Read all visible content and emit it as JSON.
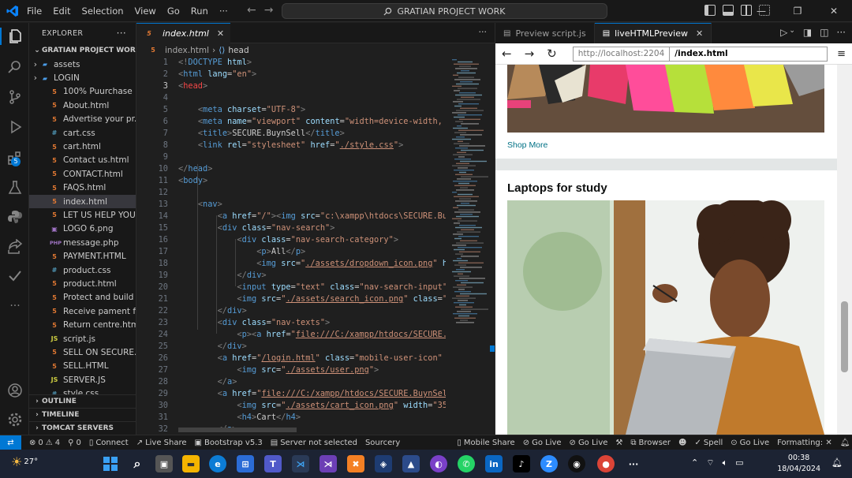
{
  "menu": [
    "File",
    "Edit",
    "Selection",
    "View",
    "Go",
    "Run",
    "···"
  ],
  "command_center": "GRATIAN PROJECT WORK",
  "sidebar": {
    "title": "EXPLORER",
    "root": "GRATIAN PROJECT WORK",
    "items": [
      {
        "label": "assets",
        "type": "folder"
      },
      {
        "label": "LOGIN",
        "type": "folder"
      },
      {
        "label": "100% Puurchase ...",
        "type": "html"
      },
      {
        "label": "About.html",
        "type": "html"
      },
      {
        "label": "Advertise your pr...",
        "type": "html"
      },
      {
        "label": "cart.css",
        "type": "css"
      },
      {
        "label": "cart.html",
        "type": "html"
      },
      {
        "label": "Contact us.html",
        "type": "html"
      },
      {
        "label": "CONTACT.html",
        "type": "html"
      },
      {
        "label": "FAQS.html",
        "type": "html"
      },
      {
        "label": "index.html",
        "type": "html",
        "selected": true
      },
      {
        "label": "LET US HELP YOU...",
        "type": "html"
      },
      {
        "label": "LOGO 6.png",
        "type": "png"
      },
      {
        "label": "message.php",
        "type": "php"
      },
      {
        "label": "PAYMENT.HTML",
        "type": "html"
      },
      {
        "label": "product.css",
        "type": "css"
      },
      {
        "label": "product.html",
        "type": "html"
      },
      {
        "label": "Protect and build ...",
        "type": "html"
      },
      {
        "label": "Receive pament f...",
        "type": "html"
      },
      {
        "label": "Return centre.html",
        "type": "html"
      },
      {
        "label": "script.js",
        "type": "js"
      },
      {
        "label": "SELL ON SECURE....",
        "type": "html"
      },
      {
        "label": "SELL.HTML",
        "type": "html"
      },
      {
        "label": "SERVER.JS",
        "type": "js"
      },
      {
        "label": "style.css",
        "type": "css"
      }
    ],
    "sections": [
      "OUTLINE",
      "TIMELINE",
      "TOMCAT SERVERS"
    ]
  },
  "editor": {
    "tab": "index.html",
    "breadcrumb_file": "index.html",
    "breadcrumb_symbol": "head",
    "current_line": 3
  },
  "preview": {
    "tabs": [
      "Preview script.js",
      "liveHTMLPreview"
    ],
    "url_host": "http://localhost:2204",
    "url_path": "/index.html",
    "shop_more": "Shop More",
    "card_title": "Laptops for study"
  },
  "status": {
    "problems": "0",
    "warnings": "4",
    "ports": "0",
    "items": [
      "Connect",
      "Live Share",
      "Bootstrap v5.3",
      "Server not selected",
      "Sourcery",
      "Mobile Share",
      "Go Live",
      "Go Live",
      "Browser",
      "Spell",
      "Go Live",
      "Formatting: ✕"
    ]
  },
  "taskbar": {
    "weather": "27°",
    "time": "00:38",
    "date": "18/04/2024"
  },
  "colors": {
    "accent": "#0078d4",
    "tag": "#569cd6",
    "attr": "#9cdcfe",
    "string": "#ce9178"
  }
}
